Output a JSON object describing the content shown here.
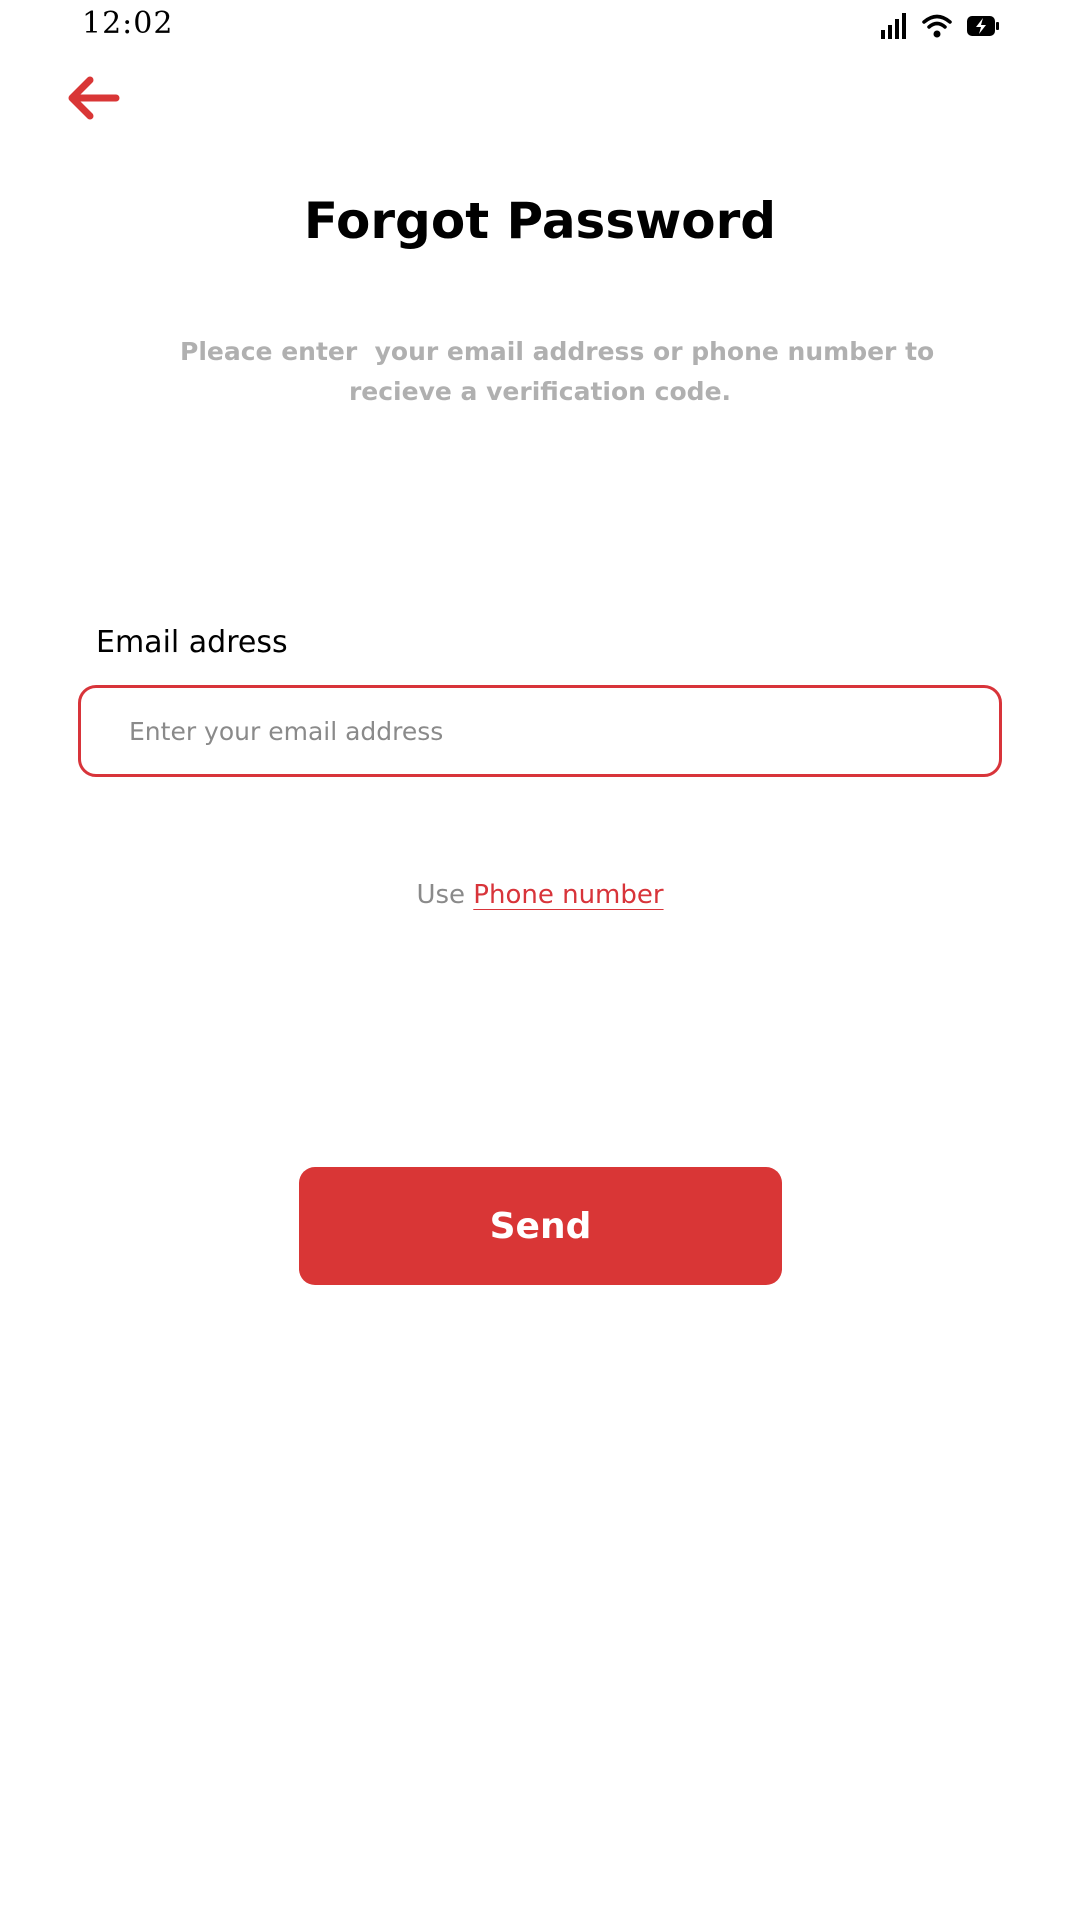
{
  "status_bar": {
    "time": "12:02",
    "icons": [
      "signal-icon",
      "wifi-icon",
      "battery-charging-icon"
    ]
  },
  "header": {
    "back_icon": "arrow-left-icon"
  },
  "main": {
    "title": "Forgot Password",
    "subtitle_line1": "Pleace enter  your email address or phone number to",
    "subtitle_line2": "recieve a verification code.",
    "email_label": "Email adress",
    "email_placeholder": "Enter your email address",
    "email_value": "",
    "alt_prefix": "Use",
    "alt_link": "Phone number",
    "send_label": "Send"
  },
  "colors": {
    "accent": "#d93636",
    "subtitle": "#b0b0b0",
    "placeholder": "#8a8a8a"
  }
}
